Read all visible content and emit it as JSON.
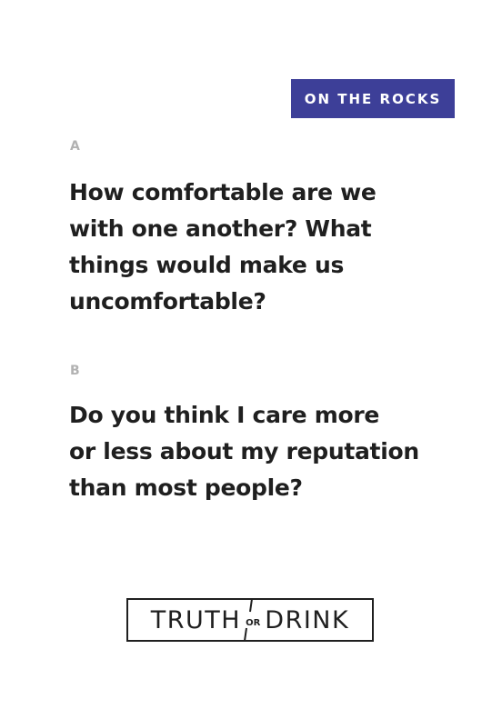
{
  "badge": {
    "label": "ON THE ROCKS",
    "color": "#3d3f98"
  },
  "question_a": {
    "label": "A",
    "lines": [
      "How comfortable are we",
      "with one another? What",
      "things would make us",
      "uncomfortable?"
    ]
  },
  "question_b": {
    "label": "B",
    "lines": [
      "Do you think I care more",
      "or less about my reputation",
      "than most people?"
    ]
  },
  "logo": {
    "left": "TRUTH",
    "middle": "OR",
    "right": "DRINK"
  }
}
